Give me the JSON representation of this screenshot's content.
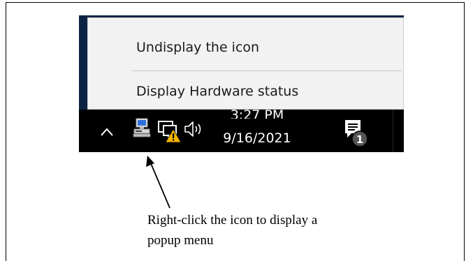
{
  "context_menu": {
    "items": [
      {
        "label": "Undisplay the icon"
      },
      {
        "label": "Display Hardware status"
      }
    ]
  },
  "taskbar": {
    "clock": {
      "time": "3:27 PM",
      "date": "9/16/2021"
    },
    "notification_badge": "1",
    "icons": [
      "chevron-up-icon",
      "hardware-status-icon",
      "network-warning-icon",
      "volume-icon",
      "action-center-icon"
    ]
  },
  "caption": {
    "line1": "Right-click the icon to display a",
    "line2": "popup menu"
  },
  "colors": {
    "taskbar": "#000000",
    "menu_background": "#f2f2f2",
    "desktop": "#0d2444",
    "warning": "#f5b400"
  }
}
